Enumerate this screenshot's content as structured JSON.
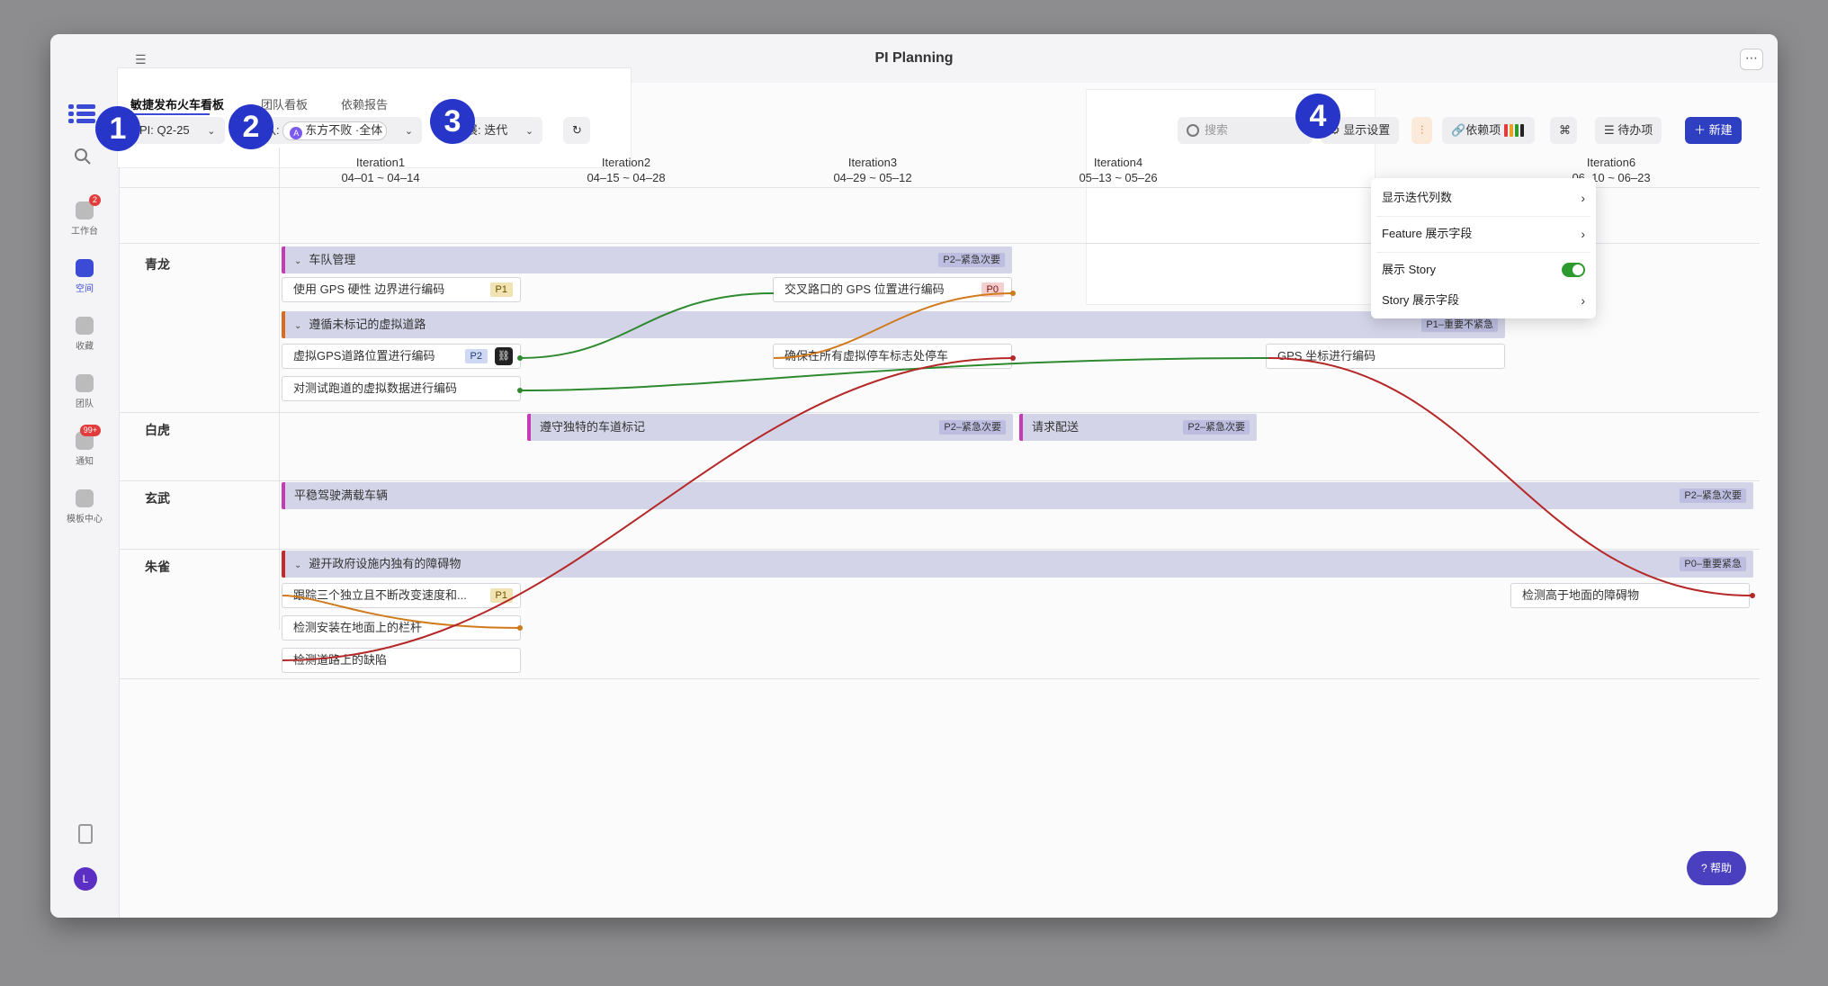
{
  "app": {
    "title": "PI Planning"
  },
  "sidebar": {
    "items": [
      {
        "label": "工作台",
        "badge": "2"
      },
      {
        "label": "空间"
      },
      {
        "label": "收藏"
      },
      {
        "label": "团队"
      },
      {
        "label": "通知",
        "badge": "99+"
      },
      {
        "label": "模板中心"
      }
    ],
    "avatar": "L"
  },
  "tabs": [
    "敏捷发布火车看板",
    "团队看板",
    "依赖报告"
  ],
  "filters": {
    "pi_label": "PI:",
    "pi_value": "Q2-25",
    "team_label": "团队:",
    "team_value": "东方不败 ·全体",
    "team_icon": "A",
    "progress_label": "进展:",
    "progress_value": "迭代"
  },
  "toolbar": {
    "search_placeholder": "搜索",
    "display_settings": "显示设置",
    "dependencies": "依赖项",
    "todo": "待办项",
    "new": "新建"
  },
  "menu": {
    "items": [
      "显示迭代列数",
      "Feature 展示字段",
      "展示 Story",
      "Story 展示字段"
    ],
    "show_story_enabled": true
  },
  "iterations": [
    {
      "name": "Iteration1",
      "range": "04–01 ~ 04–14"
    },
    {
      "name": "Iteration2",
      "range": "04–15 ~ 04–28"
    },
    {
      "name": "Iteration3",
      "range": "04–29 ~ 05–12"
    },
    {
      "name": "Iteration4",
      "range": "05–13 ~ 05–26"
    },
    {
      "name": "Iteration6",
      "range": "06–10 ~ 06–23"
    }
  ],
  "teams": [
    "青龙",
    "白虎",
    "玄武",
    "朱雀"
  ],
  "features": {
    "f1": {
      "title": "车队管理",
      "priority": "P2–紧急次要"
    },
    "f2": {
      "title": "遵循未标记的虚拟道路",
      "priority": "P1–重要不紧急"
    },
    "f3": {
      "title": "遵守独特的车道标记",
      "priority": "P2–紧急次要"
    },
    "f4": {
      "title": "请求配送",
      "priority": "P2–紧急次要"
    },
    "f5": {
      "title": "平稳驾驶满载车辆",
      "priority": "P2–紧急次要"
    },
    "f6": {
      "title": "避开政府设施内独有的障碍物",
      "priority": "P0–重要紧急"
    }
  },
  "stories": {
    "s1": {
      "title": "使用 GPS 硬性 边界进行编码",
      "tag": "P1"
    },
    "s2": {
      "title": "交叉路口的 GPS 位置进行编码",
      "tag": "P0"
    },
    "s3": {
      "title": "虚拟GPS道路位置进行编码",
      "tag": "P2"
    },
    "s4": {
      "title": "确保在所有虚拟停车标志处停车"
    },
    "s5": {
      "title": "GPS 坐标进行编码"
    },
    "s6": {
      "title": "对测试跑道的虚拟数据进行编码"
    },
    "s7": {
      "title": "跟踪三个独立且不断改变速度和...",
      "tag": "P1"
    },
    "s8": {
      "title": "检测安装在地面上的栏杆"
    },
    "s9": {
      "title": "检测道路上的缺陷"
    },
    "s10": {
      "title": "检测高于地面的障碍物"
    }
  },
  "callouts": [
    "1",
    "2",
    "3",
    "4"
  ],
  "help": "帮助",
  "colors": {
    "accent": "#2f3fc2",
    "green_link": "#2f8a2f",
    "orange_link": "#d07a1c",
    "red_link": "#b52828"
  }
}
